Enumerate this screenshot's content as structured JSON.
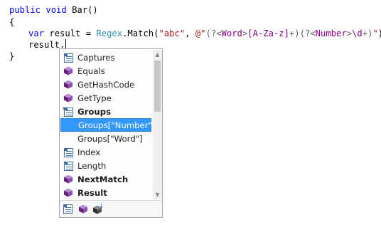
{
  "editor": {
    "line1": {
      "kw1": "public",
      "kw2": "void",
      "name": "Bar()"
    },
    "line2": "{",
    "line3": {
      "kw": "var",
      "pre": "result = ",
      "type": "Regex",
      "method": ".Match(",
      "str1": "\"abc\"",
      "comma": ", ",
      "verbatim": "@\"",
      "g1open": "(?<",
      "g1name": "Word",
      "g1close": ">",
      "cls": "[A-Za-z]",
      "plus1": "+",
      "paren1": ")",
      "g2open": "(?<",
      "g2name": "Number",
      "g2close": ">",
      "digit": "\\d",
      "plus2": "+",
      "paren2": ")",
      "endq": "\"",
      "tail": ");"
    },
    "line4": "result.",
    "line5": "}"
  },
  "completion": {
    "items": [
      {
        "label": "Captures",
        "icon": "property-icon",
        "bold": false
      },
      {
        "label": "Equals",
        "icon": "method-icon",
        "bold": false
      },
      {
        "label": "GetHashCode",
        "icon": "method-icon",
        "bold": false
      },
      {
        "label": "GetType",
        "icon": "method-icon",
        "bold": false
      },
      {
        "label": "Groups",
        "icon": "property-extension-icon",
        "bold": true
      },
      {
        "label": "Groups[\"Number\"]",
        "icon": "",
        "bold": false,
        "selected": true
      },
      {
        "label": "Groups[\"Word\"]",
        "icon": "",
        "bold": false
      },
      {
        "label": "Index",
        "icon": "property-icon",
        "bold": false
      },
      {
        "label": "Length",
        "icon": "property-icon",
        "bold": false
      },
      {
        "label": "NextMatch",
        "icon": "method-icon",
        "bold": true
      },
      {
        "label": "Result",
        "icon": "method-icon",
        "bold": true
      }
    ],
    "filters": [
      "properties-filter-icon",
      "methods-filter-icon",
      "extension-methods-filter-icon"
    ],
    "colors": {
      "selection": "#3399ff",
      "method": "#68217a",
      "property": "#3a6ea5"
    }
  }
}
